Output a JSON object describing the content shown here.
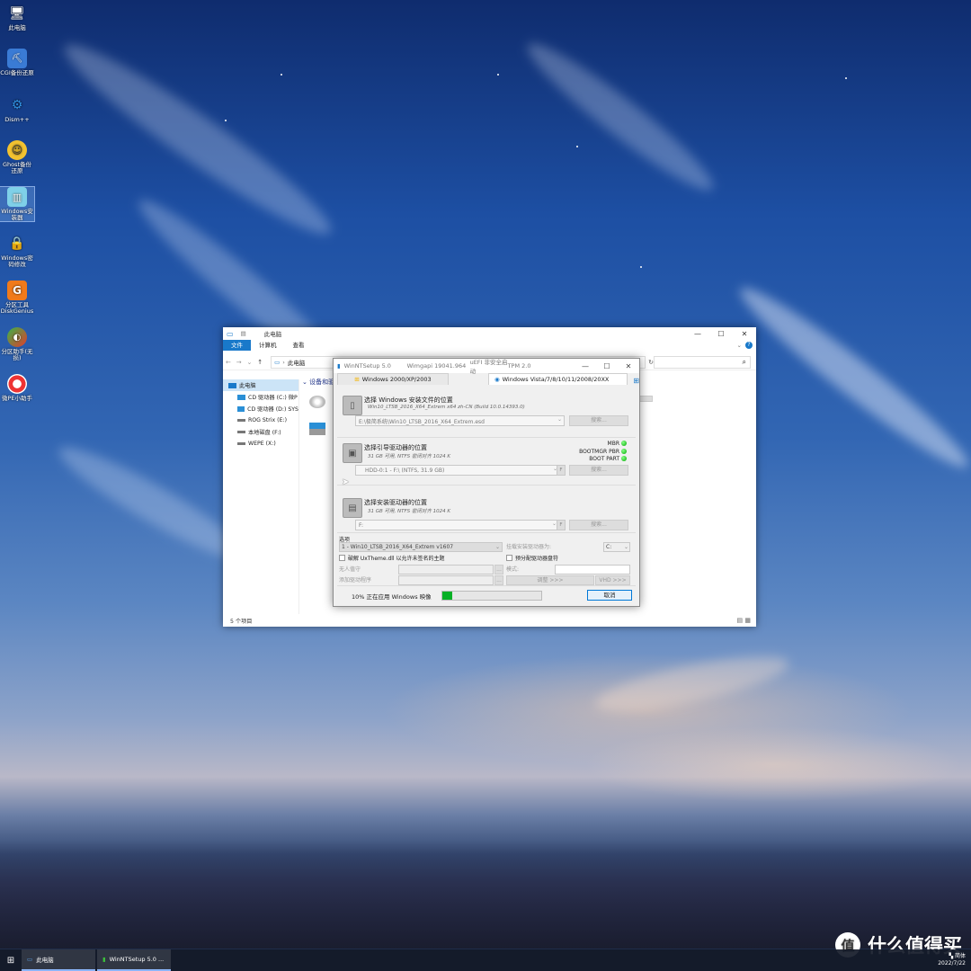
{
  "desktop": {
    "icons": [
      {
        "label": "此电脑",
        "icon": "computer-icon"
      },
      {
        "label": "CGI备份还原",
        "icon": "cgi-icon"
      },
      {
        "label": "Dism++",
        "icon": "gears-icon"
      },
      {
        "label": "Ghost备份还原",
        "icon": "ghost-icon"
      },
      {
        "label": "Windows安装器",
        "icon": "installer-icon"
      },
      {
        "label": "Windows密码修改",
        "icon": "lock-icon"
      },
      {
        "label": "分区工具DiskGenius",
        "icon": "diskgenius-icon"
      },
      {
        "label": "分区助手(无损)",
        "icon": "partition-assistant-icon"
      },
      {
        "label": "微PE小助手",
        "icon": "lifebuoy-icon"
      }
    ]
  },
  "explorer": {
    "title": "此电脑",
    "ribbon_tabs": [
      "文件",
      "计算机",
      "查看"
    ],
    "address": "此电脑",
    "content_header": "设备和驱",
    "tree": {
      "root": "此电脑",
      "items": [
        "CD 驱动器 (C:) 微P",
        "CD 驱动器 (D:) SYS",
        "ROG Strix (E:)",
        "本地磁盘 (F:)",
        "WEPE (X:)"
      ]
    },
    "status": "5 个项目"
  },
  "winntsetup": {
    "title": "WinNTSetup 5.0",
    "wimgapi": "Wimgapi 19041.964",
    "uefi": "uEFI 非安全启动",
    "tpm": "TPM 2.0",
    "tabs": [
      "Windows 2000/XP/2003",
      "Windows Vista/7/8/10/11/2008/20XX"
    ],
    "source": {
      "heading": "选择 Windows 安装文件的位置",
      "sub": "Win10_LTSB_2016_X64_Extrem  x64 zh-CN (Build 10.0.14393.0)",
      "value": "E:\\极简系统\\Win10_LTSB_2016_X64_Extrem.esd",
      "search": "搜索..."
    },
    "boot": {
      "heading": "选择引导驱动器的位置",
      "sub": "31 GB 可用, NTFS 密闭对齐 1024 K",
      "value": "HDD-0:1 - F:\\  (NTFS, 31.9 GB)",
      "f": "F",
      "search": "搜索...",
      "indicators": [
        "MBR",
        "BOOTMGR PBR",
        "BOOT PART"
      ]
    },
    "install": {
      "heading": "选择安装驱动器的位置",
      "sub": "31 GB 可用, NTFS 密闭对齐 1024 K",
      "value": "F:",
      "f": "F",
      "search": "搜索..."
    },
    "options": {
      "label": "选项",
      "edition": "1 - Win10_LTSB_2016_X64_Extrem v1607",
      "mount_label": "挂载安装驱动器为:",
      "mount_value": "C:",
      "uxtheme": "破解 UxTheme.dll 以允许未签名的主题",
      "prealloc": "预分配驱动器盘符",
      "unattended": "无人值守",
      "add_drivers": "添加驱动程序",
      "mode": "模式:",
      "tweaks": "调整 >>>",
      "vhd": "VHD >>>",
      "browse": "..."
    },
    "progress": {
      "status": "10% 正在应用 Windows 映像",
      "value": 0.1,
      "cancel": "取消"
    }
  },
  "taskbar": {
    "items": [
      "此电脑",
      "WinNTSetup 5.0 ..."
    ],
    "ime": "简体",
    "date": "2022/7/22"
  },
  "watermark": {
    "logo": "值",
    "text": "什么值得买"
  },
  "colors": {
    "accent": "#1979ca",
    "progress": "#06b025",
    "led": "#00aa00"
  }
}
